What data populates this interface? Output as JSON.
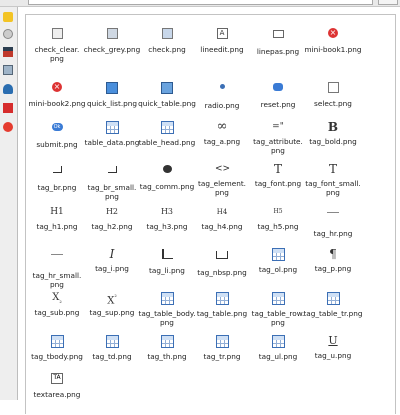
{
  "browser": {
    "accent": "#3c6fb5",
    "sidebar_icons": [
      "star-icon",
      "history-icon",
      "bookmark-icon",
      "tools-icon",
      "mail-icon",
      "book-icon",
      "pin-icon"
    ]
  },
  "files": [
    {
      "name": "check_clear.\npng",
      "icon": "check-clear-icon"
    },
    {
      "name": "check_grey.png",
      "icon": "check-grey-icon"
    },
    {
      "name": "check.png",
      "icon": "check-icon"
    },
    {
      "name": "lineedit.png",
      "icon": "lineedit-icon"
    },
    {
      "name": "linepas.png",
      "icon": "linepas-icon"
    },
    {
      "name": "mini-book1.png",
      "icon": "mini-book-icon"
    },
    {
      "name": "mini-book2.png",
      "icon": "mini-book-icon"
    },
    {
      "name": "quick_list.png",
      "icon": "quick-list-icon"
    },
    {
      "name": "quick_table.png",
      "icon": "quick-table-icon"
    },
    {
      "name": "radio.png",
      "icon": "radio-icon"
    },
    {
      "name": "reset.png",
      "icon": "reset-icon"
    },
    {
      "name": "select.png",
      "icon": "select-icon"
    },
    {
      "name": "submit.png",
      "icon": "submit-icon"
    },
    {
      "name": "table_data.png",
      "icon": "table-icon"
    },
    {
      "name": "table_head.png",
      "icon": "table-icon"
    },
    {
      "name": "tag_a.png",
      "icon": "link-icon"
    },
    {
      "name": "tag_attribute.\npng",
      "icon": "attribute-icon"
    },
    {
      "name": "tag_bold.png",
      "icon": "bold-icon"
    },
    {
      "name": "tag_br.png",
      "icon": "br-icon"
    },
    {
      "name": "tag_br_small.\npng",
      "icon": "br-icon"
    },
    {
      "name": "tag_comm.png",
      "icon": "comment-icon"
    },
    {
      "name": "tag_element.\npng",
      "icon": "element-icon"
    },
    {
      "name": "tag_font.png",
      "icon": "font-icon"
    },
    {
      "name": "tag_font_small.\npng",
      "icon": "font-icon"
    },
    {
      "name": "tag_h1.png",
      "icon": "h1-icon"
    },
    {
      "name": "tag_h2.png",
      "icon": "h2-icon"
    },
    {
      "name": "tag_h3.png",
      "icon": "h3-icon"
    },
    {
      "name": "tag_h4.png",
      "icon": "h4-icon"
    },
    {
      "name": "tag_h5.png",
      "icon": "h5-icon"
    },
    {
      "name": "tag_hr.png",
      "icon": "hr-icon"
    },
    {
      "name": "tag_hr_small.\npng",
      "icon": "hr-icon"
    },
    {
      "name": "tag_i.png",
      "icon": "italic-icon"
    },
    {
      "name": "tag_li.png",
      "icon": "li-icon"
    },
    {
      "name": "tag_nbsp.png",
      "icon": "nbsp-icon"
    },
    {
      "name": "tag_ol.png",
      "icon": "ol-icon"
    },
    {
      "name": "tag_p.png",
      "icon": "paragraph-icon"
    },
    {
      "name": "tag_sub.png",
      "icon": "sub-icon"
    },
    {
      "name": "tag_sup.png",
      "icon": "sup-icon"
    },
    {
      "name": "tag_table_body.\npng",
      "icon": "table-icon"
    },
    {
      "name": "tag_table.png",
      "icon": "table-icon"
    },
    {
      "name": "tag_table_row.\npng",
      "icon": "table-icon"
    },
    {
      "name": "tag_table_tr.png",
      "icon": "table-icon"
    },
    {
      "name": "tag_tbody.png",
      "icon": "table-icon"
    },
    {
      "name": "tag_td.png",
      "icon": "table-icon"
    },
    {
      "name": "tag_th.png",
      "icon": "table-icon"
    },
    {
      "name": "tag_tr.png",
      "icon": "table-icon"
    },
    {
      "name": "tag_ul.png",
      "icon": "ul-icon"
    },
    {
      "name": "tag_u.png",
      "icon": "underline-icon"
    },
    {
      "name": "textarea.png",
      "icon": "textarea-icon"
    }
  ]
}
